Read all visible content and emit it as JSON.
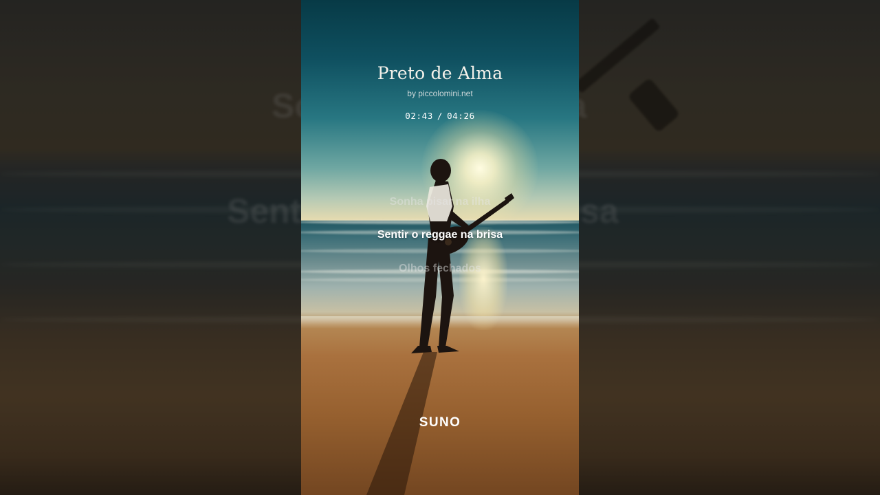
{
  "song": {
    "title": "Preto de Alma",
    "artist": "by piccolomini.net",
    "current_time": "02:43",
    "separator": "/",
    "total_time": "04:26"
  },
  "lyrics": {
    "previous": "Sonha pisar na ilha",
    "current": "Sentir o reggae na brisa",
    "next": "Olhos fechados"
  },
  "brand": {
    "logo_text": "SUNO"
  },
  "colors": {
    "active_lyric": "#ffffff",
    "dim_lyric": "rgba(230,230,230,0.45)"
  }
}
